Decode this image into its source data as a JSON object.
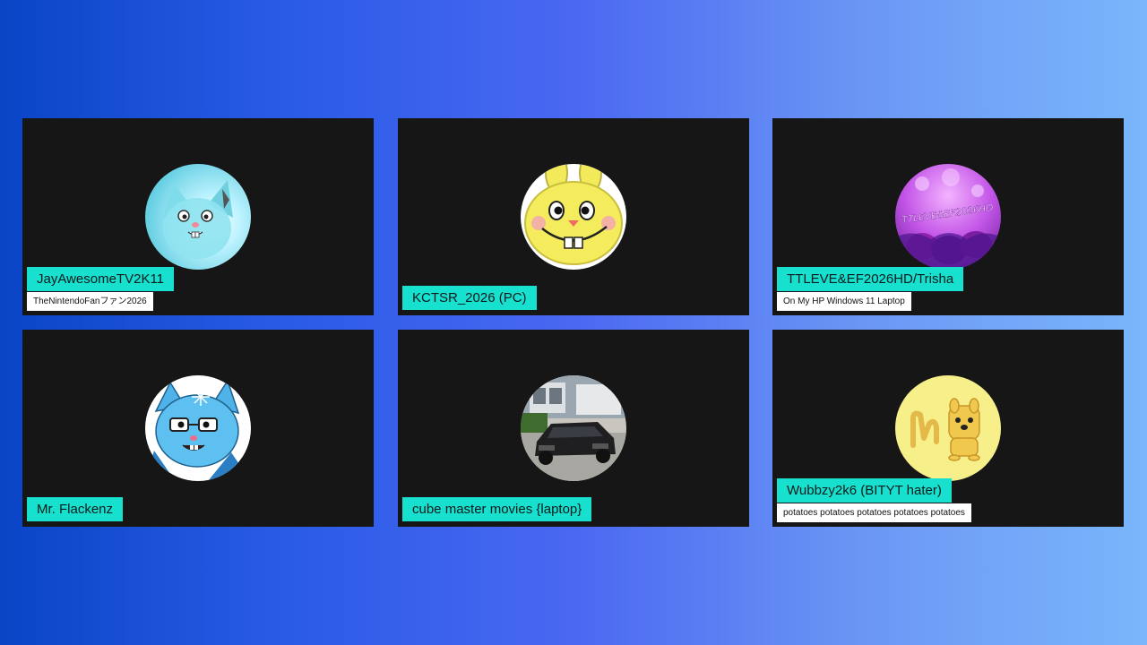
{
  "participants": [
    {
      "name": "JayAwesomeTV2K11",
      "subtitle": "TheNintendoFanファン2026",
      "avatar_icon": "blue-cartoon-cat-icon"
    },
    {
      "name": "KCTSR_2026 (PC)",
      "subtitle": "",
      "avatar_icon": "yellow-cartoon-bunny-icon"
    },
    {
      "name": "TTLEVE&EF2026HD/Trisha",
      "subtitle": "On My HP Windows 11 Laptop",
      "avatar_icon": "purple-eggs-logo-icon",
      "avatar_text": "TTLEVE&EF2026HD"
    },
    {
      "name": "Mr. Flackenz",
      "subtitle": "",
      "avatar_icon": "blue-cat-with-glasses-icon"
    },
    {
      "name": "cube master movies {laptop}",
      "subtitle": "",
      "avatar_icon": "black-car-photo-icon"
    },
    {
      "name": "Wubbzy2k6 (BITYT hater)",
      "subtitle": "potatoes potatoes potatoes potatoes potatoes",
      "avatar_icon": "wubbzy-character-icon"
    }
  ],
  "colors": {
    "tile_background": "#161616",
    "name_tag": "#17e0cf",
    "subtitle_tag": "#ffffff"
  }
}
